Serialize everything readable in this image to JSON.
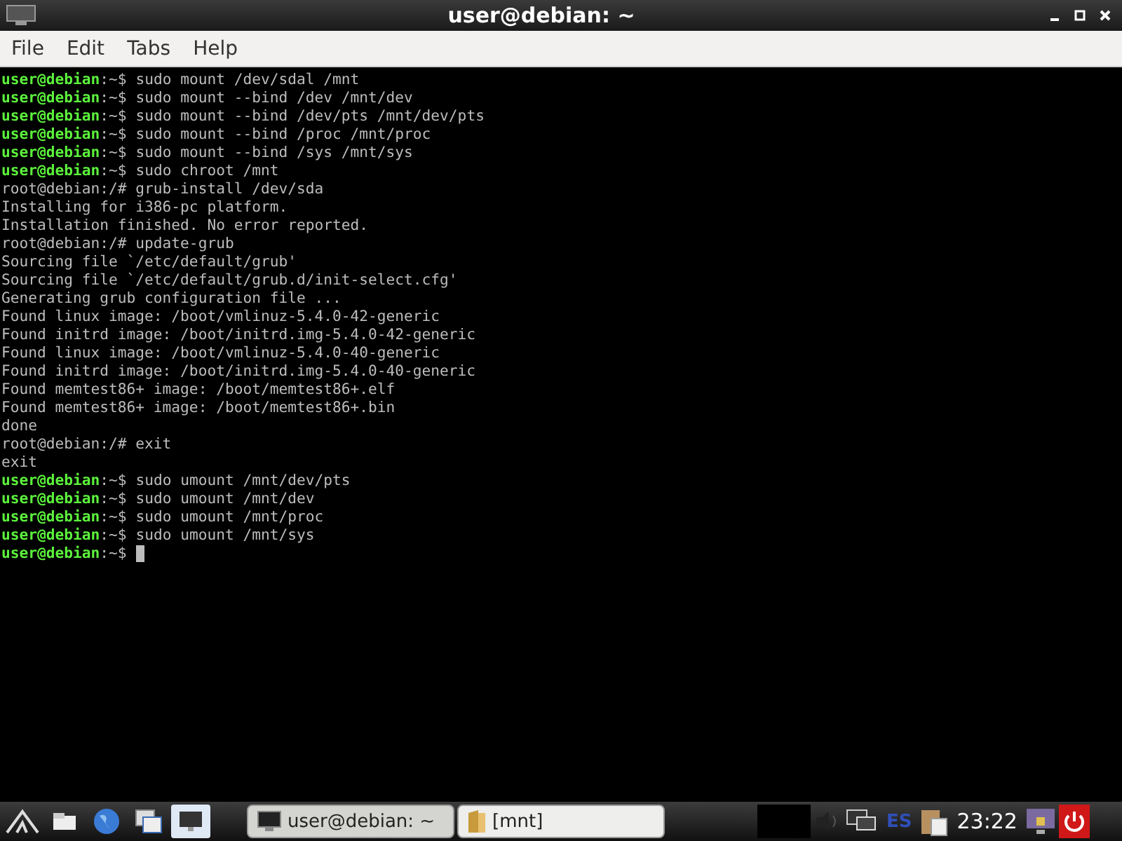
{
  "window": {
    "title": "user@debian: ~"
  },
  "menu": [
    "File",
    "Edit",
    "Tabs",
    "Help"
  ],
  "terminal": {
    "lines": [
      {
        "kind": "prompt",
        "user": "user@debian",
        "prompt": ":~$",
        "command": "sudo mount /dev/sdal /mnt"
      },
      {
        "kind": "prompt",
        "user": "user@debian",
        "prompt": ":~$",
        "command": "sudo mount --bind /dev /mnt/dev"
      },
      {
        "kind": "prompt",
        "user": "user@debian",
        "prompt": ":~$",
        "command": "sudo mount --bind /dev/pts /mnt/dev/pts"
      },
      {
        "kind": "prompt",
        "user": "user@debian",
        "prompt": ":~$",
        "command": "sudo mount --bind /proc /mnt/proc"
      },
      {
        "kind": "prompt",
        "user": "user@debian",
        "prompt": ":~$",
        "command": "sudo mount --bind /sys /mnt/sys"
      },
      {
        "kind": "prompt",
        "user": "user@debian",
        "prompt": ":~$",
        "command": "sudo chroot /mnt"
      },
      {
        "kind": "output",
        "text": "root@debian:/# grub-install /dev/sda"
      },
      {
        "kind": "output",
        "text": "Installing for i386-pc platform."
      },
      {
        "kind": "output",
        "text": "Installation finished. No error reported."
      },
      {
        "kind": "output",
        "text": "root@debian:/# update-grub"
      },
      {
        "kind": "output",
        "text": "Sourcing file `/etc/default/grub'"
      },
      {
        "kind": "output",
        "text": "Sourcing file `/etc/default/grub.d/init-select.cfg'"
      },
      {
        "kind": "output",
        "text": "Generating grub configuration file ..."
      },
      {
        "kind": "output",
        "text": "Found linux image: /boot/vmlinuz-5.4.0-42-generic"
      },
      {
        "kind": "output",
        "text": "Found initrd image: /boot/initrd.img-5.4.0-42-generic"
      },
      {
        "kind": "output",
        "text": "Found linux image: /boot/vmlinuz-5.4.0-40-generic"
      },
      {
        "kind": "output",
        "text": "Found initrd image: /boot/initrd.img-5.4.0-40-generic"
      },
      {
        "kind": "output",
        "text": "Found memtest86+ image: /boot/memtest86+.elf"
      },
      {
        "kind": "output",
        "text": "Found memtest86+ image: /boot/memtest86+.bin"
      },
      {
        "kind": "output",
        "text": "done"
      },
      {
        "kind": "output",
        "text": "root@debian:/# exit"
      },
      {
        "kind": "output",
        "text": "exit"
      },
      {
        "kind": "prompt",
        "user": "user@debian",
        "prompt": ":~$",
        "command": "sudo umount /mnt/dev/pts"
      },
      {
        "kind": "prompt",
        "user": "user@debian",
        "prompt": ":~$",
        "command": "sudo umount /mnt/dev"
      },
      {
        "kind": "prompt",
        "user": "user@debian",
        "prompt": ":~$",
        "command": "sudo umount /mnt/proc"
      },
      {
        "kind": "prompt",
        "user": "user@debian",
        "prompt": ":~$",
        "command": "sudo umount /mnt/sys"
      },
      {
        "kind": "prompt",
        "user": "user@debian",
        "prompt": ":~$",
        "cursor": true
      }
    ]
  },
  "taskbar": {
    "launchers": [
      {
        "kind": "logo",
        "selected": false
      },
      {
        "kind": "files",
        "selected": false
      },
      {
        "kind": "browser",
        "selected": false
      },
      {
        "kind": "windows",
        "selected": false
      },
      {
        "kind": "desktop",
        "selected": true
      }
    ],
    "tasks": [
      {
        "kind": "terminal",
        "label": "user@debian: ~",
        "selected": true
      },
      {
        "kind": "folder",
        "label": "[mnt]",
        "selected": false
      }
    ],
    "keyboard_layout": "ES",
    "clock": "23:22"
  }
}
